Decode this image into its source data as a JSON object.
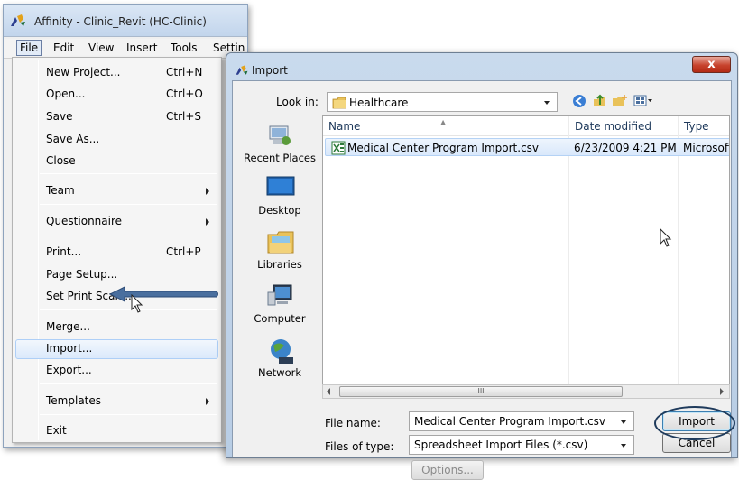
{
  "app": {
    "title": "Affinity - Clinic_Revit (HC-Clinic)",
    "menubar": [
      "File",
      "Edit",
      "View",
      "Insert",
      "Tools",
      "Settin"
    ]
  },
  "file_menu": {
    "items": [
      {
        "label": "New Project...",
        "shortcut": "Ctrl+N"
      },
      {
        "label": "Open...",
        "shortcut": "Ctrl+O"
      },
      {
        "label": "Save",
        "shortcut": "Ctrl+S"
      },
      {
        "label": "Save As...",
        "shortcut": ""
      },
      {
        "label": "Close",
        "shortcut": ""
      },
      {
        "label": "Team",
        "shortcut": ""
      },
      {
        "label": "Questionnaire",
        "shortcut": ""
      },
      {
        "label": "Print...",
        "shortcut": "Ctrl+P"
      },
      {
        "label": "Page Setup...",
        "shortcut": ""
      },
      {
        "label": "Set Print Scale...",
        "shortcut": ""
      },
      {
        "label": "Merge...",
        "shortcut": ""
      },
      {
        "label": "Import...",
        "shortcut": ""
      },
      {
        "label": "Export...",
        "shortcut": ""
      },
      {
        "label": "Templates",
        "shortcut": ""
      },
      {
        "label": "Exit",
        "shortcut": ""
      }
    ]
  },
  "dialog": {
    "title": "Import",
    "close_glyph": "x",
    "look_in_label": "Look in:",
    "look_in_value": "Healthcare",
    "places": [
      "Recent Places",
      "Desktop",
      "Libraries",
      "Computer",
      "Network"
    ],
    "columns": {
      "name": "Name",
      "date": "Date modified",
      "type": "Type"
    },
    "files": [
      {
        "name": "Medical Center Program Import.csv",
        "date": "6/23/2009 4:21 PM",
        "type": "Microsoft"
      }
    ],
    "scroll_thumb_glyph": "III",
    "file_name_label": "File name:",
    "file_name_value": "Medical Center Program Import.csv",
    "files_of_type_label": "Files of type:",
    "files_of_type_value": "Spreadsheet Import Files (*.csv)",
    "import_button": "Import",
    "cancel_button": "Cancel",
    "options_button": "Options..."
  },
  "colors": {
    "highlight_arrow": "#4a6f9e",
    "selection": "#d9e8fb",
    "close_button": "#c7432d"
  }
}
